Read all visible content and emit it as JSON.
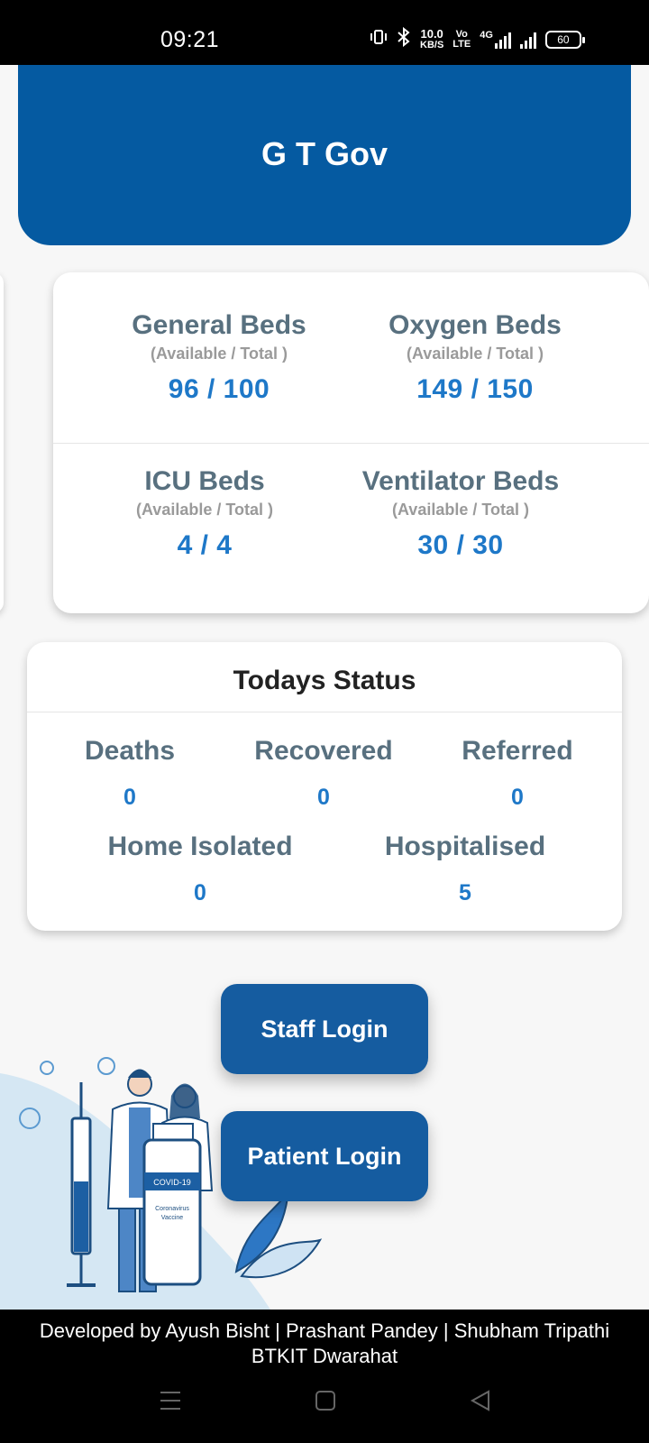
{
  "status_bar": {
    "time": "09:21",
    "net_speed_value": "10.0",
    "net_speed_unit": "KB/S",
    "volte_top": "Vo",
    "volte_bottom": "LTE",
    "network_type": "4G",
    "battery": "60"
  },
  "header": {
    "title": "G T Gov"
  },
  "beds": [
    {
      "name": "General Beds",
      "sub": "(Available / Total )",
      "value": "96 / 100"
    },
    {
      "name": "Oxygen Beds",
      "sub": "(Available / Total )",
      "value": "149 / 150"
    },
    {
      "name": "ICU Beds",
      "sub": "(Available / Total )",
      "value": "4 / 4"
    },
    {
      "name": "Ventilator Beds",
      "sub": "(Available / Total )",
      "value": "30 / 30"
    }
  ],
  "todays_status": {
    "title": "Todays Status",
    "stats": [
      {
        "label": "Deaths",
        "value": "0"
      },
      {
        "label": "Recovered",
        "value": "0"
      },
      {
        "label": "Referred",
        "value": "0"
      },
      {
        "label": "Home Isolated",
        "value": "0"
      },
      {
        "label": "Hospitalised",
        "value": "5"
      }
    ]
  },
  "buttons": {
    "staff_login": "Staff Login",
    "patient_login": "Patient Login"
  },
  "illustration": {
    "vial_label": "COVID-19",
    "vial_text_1": "Coronavirus",
    "vial_text_2": "Vaccine"
  },
  "footer": {
    "credits_line1": "Developed by Ayush Bisht | Prashant Pandey | Shubham Tripathi",
    "credits_line2": "BTKIT Dwarahat"
  },
  "nav_icons": [
    "menu-icon",
    "home-icon",
    "back-icon"
  ]
}
